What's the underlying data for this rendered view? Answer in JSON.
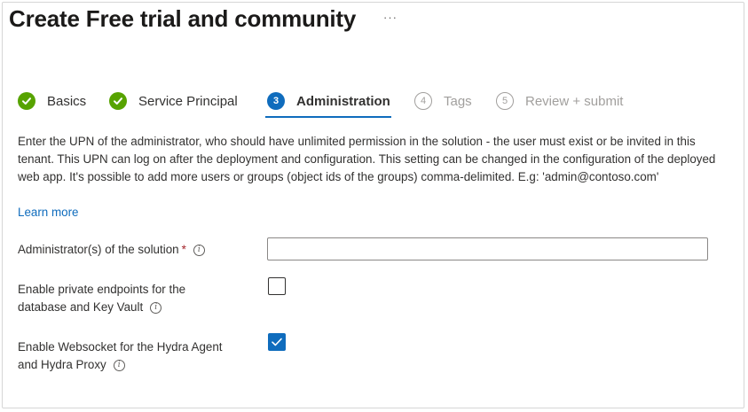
{
  "header": {
    "title": "Create Free trial and community",
    "more_label": "···"
  },
  "wizard": {
    "steps": [
      {
        "number": "",
        "label": "Basics",
        "state": "done"
      },
      {
        "number": "",
        "label": "Service Principal",
        "state": "done"
      },
      {
        "number": "3",
        "label": "Administration",
        "state": "current"
      },
      {
        "number": "4",
        "label": "Tags",
        "state": "todo"
      },
      {
        "number": "5",
        "label": "Review + submit",
        "state": "todo"
      }
    ]
  },
  "description": "Enter the UPN of the administrator, who should have unlimited permission in the solution - the user must exist or be invited in this tenant. This UPN can log on after the deployment and configuration. This setting can be changed in the configuration of the deployed web app. It's possible to add more users or groups (object ids of the groups) comma-delimited. E.g: 'admin@contoso.com'",
  "learn_more": "Learn more",
  "form": {
    "admin": {
      "label": "Administrator(s) of the solution",
      "required_mark": "*",
      "value": ""
    },
    "private_endpoints": {
      "label_line1": "Enable private endpoints for the",
      "label_line2": "database and Key Vault",
      "checked": false
    },
    "websocket": {
      "label_line1": "Enable Websocket for the Hydra Agent",
      "label_line2": "and Hydra Proxy",
      "checked": true
    }
  },
  "icons": {
    "info": "i",
    "done": "checkmark-icon"
  },
  "colors": {
    "accent": "#0f6cbd",
    "success": "#57a300",
    "required": "#a4262c",
    "disabled": "#a19f9d"
  }
}
